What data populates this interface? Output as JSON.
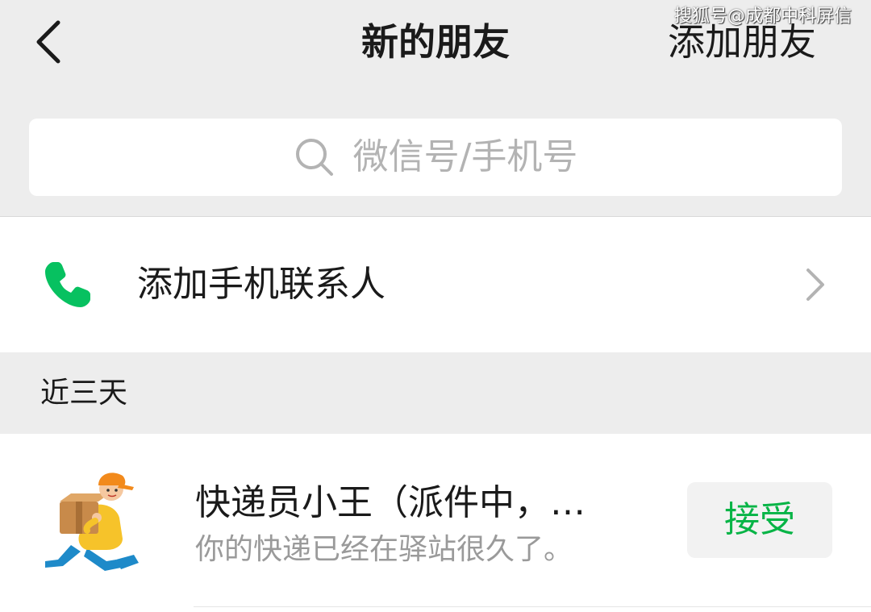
{
  "header": {
    "title": "新的朋友",
    "add_friend_label": "添加朋友",
    "back_icon": "chevron-left-icon"
  },
  "watermark": "搜狐号@成都中科屏信",
  "search": {
    "placeholder": "微信号/手机号",
    "icon": "search-icon"
  },
  "add_contact_row": {
    "label": "添加手机联系人",
    "icon": "phone-icon",
    "icon_color": "#07c160",
    "chevron_icon": "chevron-right-icon"
  },
  "section": {
    "label": "近三天"
  },
  "requests": [
    {
      "name": "快递员小王（派件中，…",
      "message": "你的快递已经在驿站很久了。",
      "avatar_icon": "courier-avatar-icon",
      "accept_label": "接受",
      "accept_color": "#07b446"
    }
  ],
  "colors": {
    "background": "#ededed",
    "card": "#ffffff",
    "accent_green": "#07c160"
  }
}
